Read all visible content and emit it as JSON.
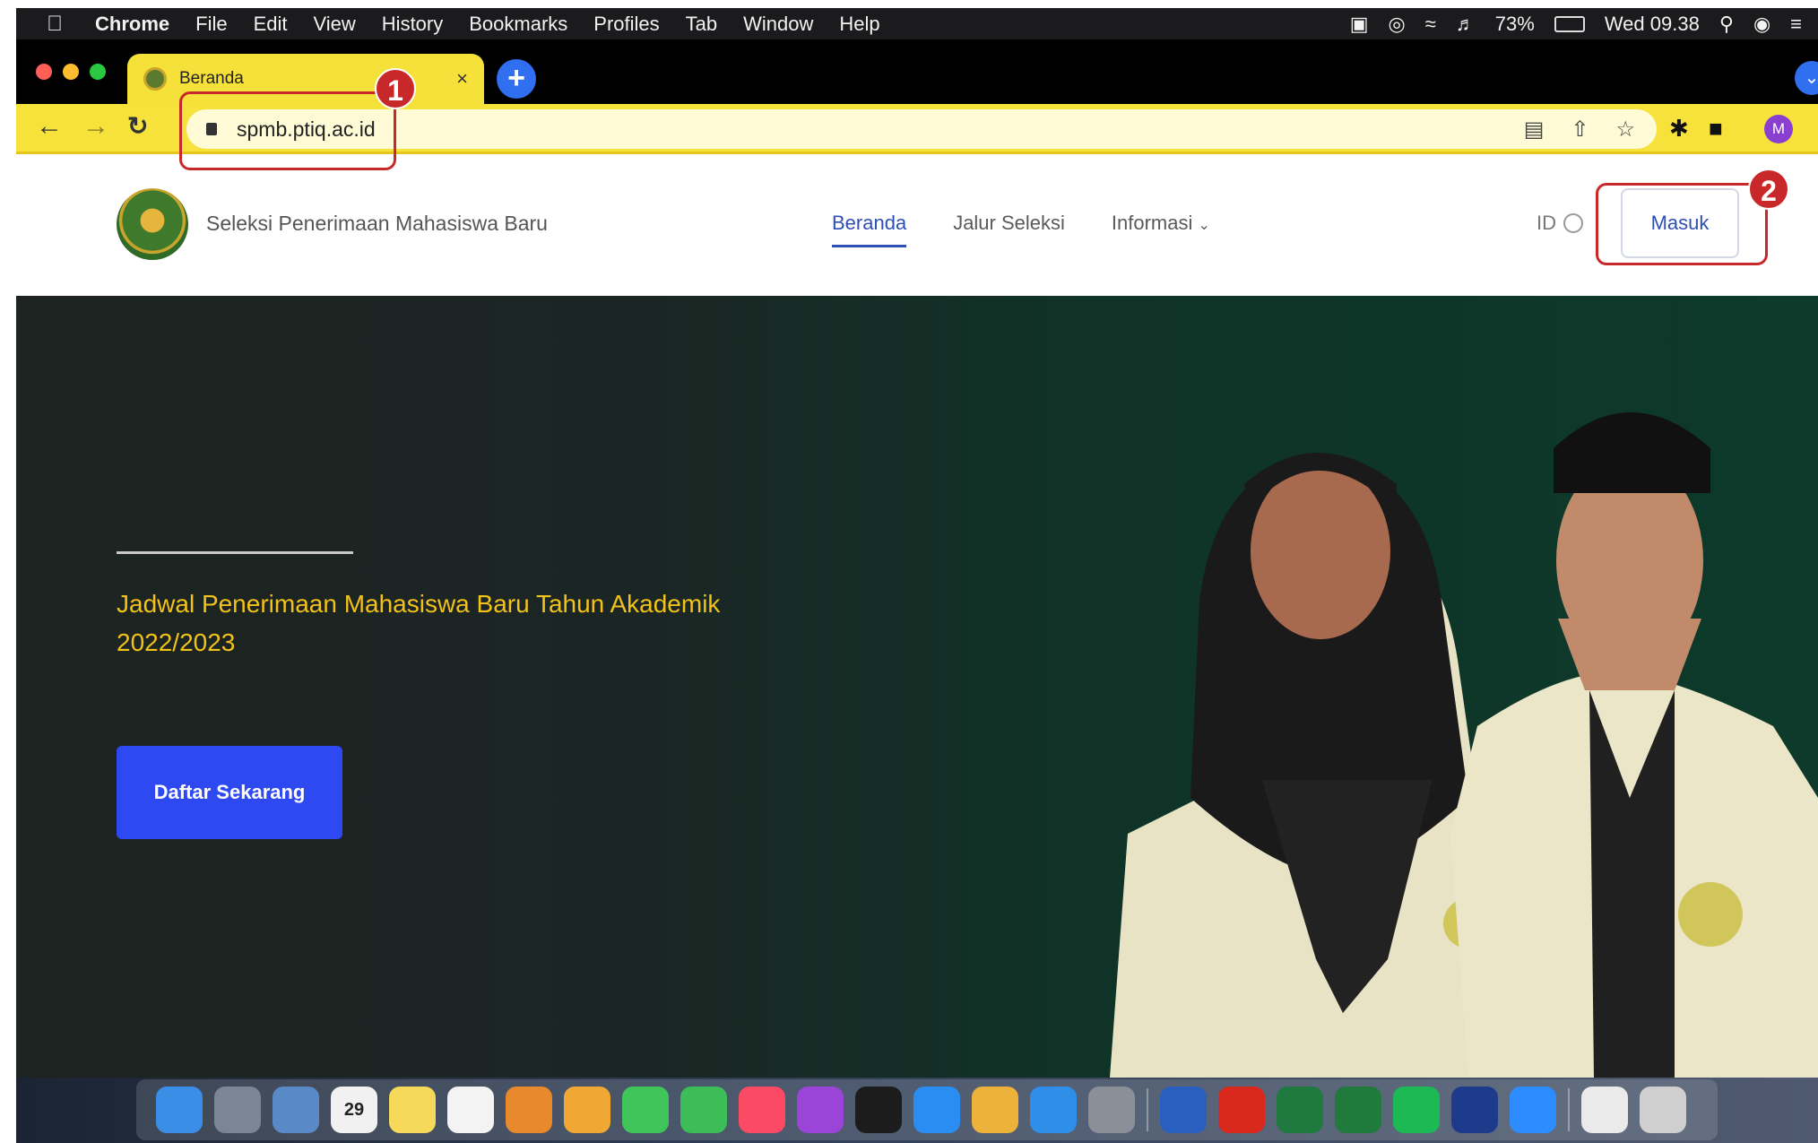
{
  "menubar": {
    "app_name": "Chrome",
    "items": [
      "File",
      "Edit",
      "View",
      "History",
      "Bookmarks",
      "Profiles",
      "Tab",
      "Window",
      "Help"
    ],
    "battery": "73%",
    "clock": "Wed 09.38"
  },
  "browser": {
    "tab_title": "Beranda",
    "url": "spmb.ptiq.ac.id",
    "profile_initial": "M"
  },
  "annotations": {
    "step1": "1",
    "step2": "2"
  },
  "site": {
    "title": "Seleksi Penerimaan Mahasiswa Baru",
    "nav": {
      "beranda": "Beranda",
      "jalur": "Jalur Seleksi",
      "informasi": "Informasi"
    },
    "lang": "ID",
    "login": "Masuk"
  },
  "hero": {
    "headline": "Jadwal Penerimaan Mahasiswa Baru Tahun Akademik 2022/2023",
    "cta": "Daftar Sekarang"
  },
  "dock": {
    "calendar_day": "29",
    "apps": [
      "finder",
      "launchpad",
      "system",
      "calendar",
      "notes",
      "reminders",
      "books",
      "photos",
      "messages",
      "facetime",
      "music",
      "podcasts",
      "tv",
      "app-store",
      "chrome",
      "safari",
      "preferences",
      "word",
      "acrobat",
      "excel",
      "vpn",
      "spotify",
      "ps",
      "zoom",
      "preview",
      "trash"
    ],
    "colors": {
      "finder": "#3a8ee6",
      "launchpad": "#7b8594",
      "system": "#5a89c7",
      "calendar": "#f1f1f1",
      "notes": "#f6d85a",
      "reminders": "#f3f3f3",
      "books": "#e9892d",
      "photos": "#f0a834",
      "messages": "#3fc55a",
      "facetime": "#3dbd57",
      "music": "#fa4a64",
      "podcasts": "#9a45d8",
      "tv": "#1c1c1c",
      "app-store": "#2a8df2",
      "chrome": "#ecb23a",
      "safari": "#2f8fe8",
      "preferences": "#8a8f98",
      "word": "#2a5fbf",
      "acrobat": "#d9291c",
      "excel": "#20793f",
      "vpn": "#1f7a3c",
      "spotify": "#1db954",
      "ps": "#1e3a8a",
      "zoom": "#2d8cff",
      "preview": "#eaeaea",
      "trash": "#cfcfcf"
    }
  }
}
